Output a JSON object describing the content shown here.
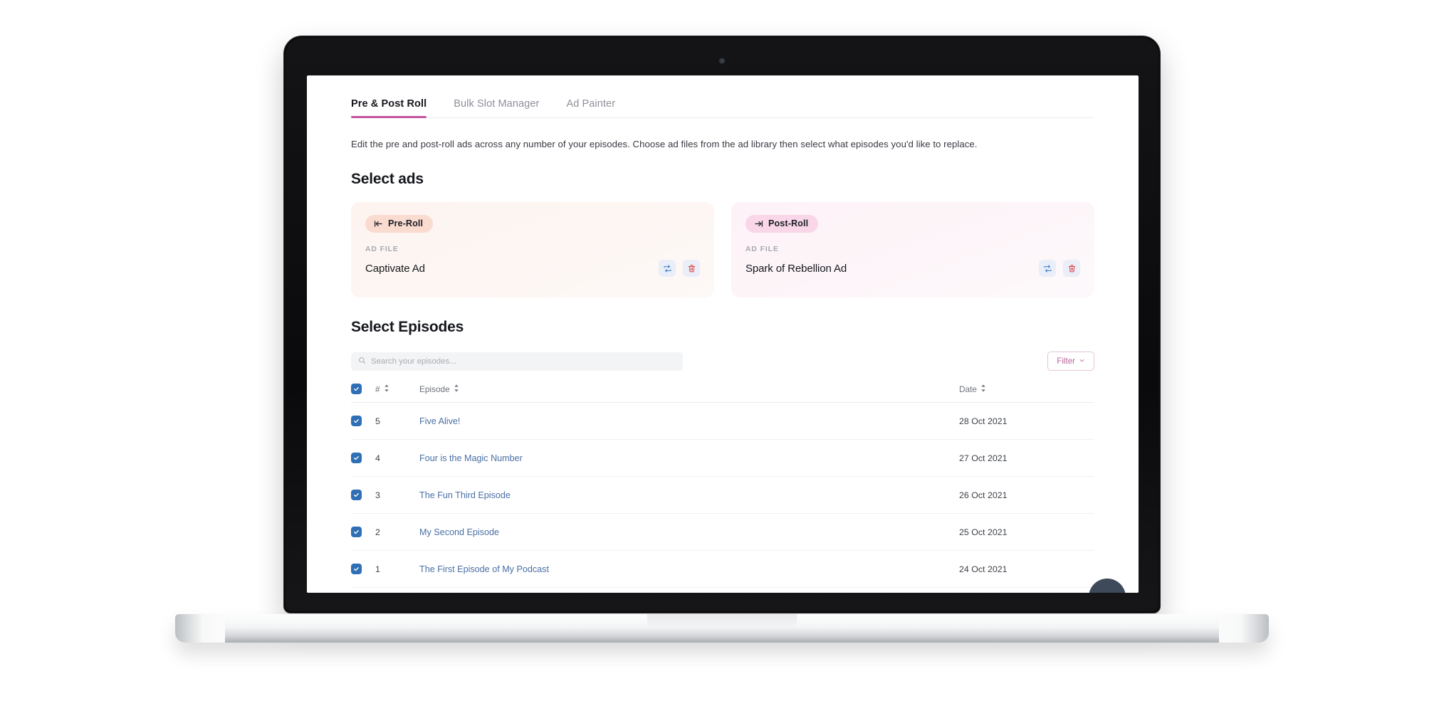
{
  "tabs": [
    {
      "label": "Pre & Post Roll",
      "active": true
    },
    {
      "label": "Bulk Slot Manager",
      "active": false
    },
    {
      "label": "Ad Painter",
      "active": false
    }
  ],
  "description": "Edit the pre and post-roll ads across any number of your episodes. Choose ad files from the ad library then select what episodes you'd like to replace.",
  "select_ads": {
    "title": "Select ads",
    "ad_file_label": "AD FILE",
    "cards": [
      {
        "badge": "Pre-Roll",
        "badge_icon": "arrow-left-to-line-icon",
        "ad_file_label": "AD FILE",
        "file_name": "Captivate Ad",
        "replace_icon": "replace-icon",
        "delete_icon": "trash-icon"
      },
      {
        "badge": "Post-Roll",
        "badge_icon": "arrow-right-from-line-icon",
        "ad_file_label": "AD FILE",
        "file_name": "Spark of Rebellion Ad",
        "replace_icon": "replace-icon",
        "delete_icon": "trash-icon"
      }
    ]
  },
  "select_episodes": {
    "title": "Select Episodes",
    "search": {
      "value": "",
      "placeholder": "Search your episodes..."
    },
    "filter_button": "Filter",
    "columns": {
      "number": "#",
      "episode": "Episode",
      "date": "Date"
    },
    "select_all_checked": true,
    "rows": [
      {
        "number": "5",
        "title": "Five Alive!",
        "date": "28 Oct 2021",
        "checked": true
      },
      {
        "number": "4",
        "title": "Four is the Magic Number",
        "date": "27 Oct 2021",
        "checked": true
      },
      {
        "number": "3",
        "title": "The Fun Third Episode",
        "date": "26 Oct 2021",
        "checked": true
      },
      {
        "number": "2",
        "title": "My Second Episode",
        "date": "25 Oct 2021",
        "checked": true
      },
      {
        "number": "1",
        "title": "The First Episode of My Podcast",
        "date": "24 Oct 2021",
        "checked": true
      }
    ]
  },
  "colors": {
    "accent_pink": "#c4559d",
    "pre_roll_badge": "#fadbd0",
    "post_roll_badge": "#f9d6e8",
    "link_blue": "#4a6fa5",
    "checkbox_blue": "#2f6fb5",
    "delete_red": "#e04a4a"
  },
  "chat_widget_icon": "chat-bubble-icon"
}
